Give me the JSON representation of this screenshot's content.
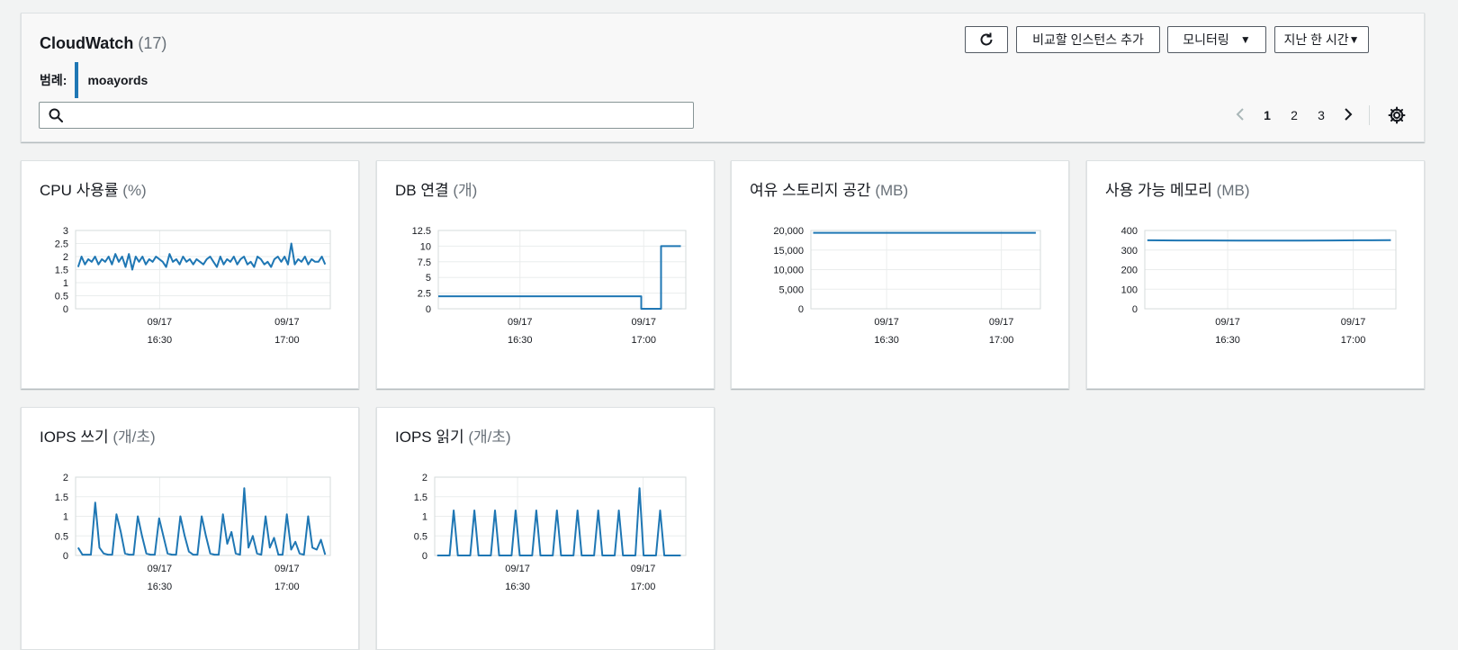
{
  "header": {
    "title": "CloudWatch",
    "count": "(17)",
    "legend_label": "범례:",
    "legend_value": "moayords",
    "search_placeholder": "",
    "buttons": {
      "compare": "비교할 인스턴스 추가",
      "monitoring": "모니터링",
      "time": "지난 한 시간"
    },
    "pages": [
      "1",
      "2",
      "3"
    ],
    "current_page": "1",
    "accent_color": "#1f77b4"
  },
  "cards": [
    {
      "title": "CPU 사용률",
      "unit": "(%)",
      "chart_data": {
        "type": "line",
        "y_ticks": [
          "3",
          "2.5",
          "2",
          "1.5",
          "1",
          "0.5",
          "0"
        ],
        "ylim": [
          0,
          3
        ],
        "x_ticks": [
          {
            "date": "09/17",
            "time": "16:30"
          },
          {
            "date": "09/17",
            "time": "17:00"
          }
        ],
        "x_tick_pos": [
          0.33,
          0.83
        ],
        "series": [
          {
            "values": [
              1.6,
              2.0,
              1.7,
              1.9,
              1.8,
              2.0,
              1.7,
              1.9,
              1.8,
              2.0,
              1.7,
              2.1,
              1.8,
              2.0,
              1.6,
              2.1,
              1.5,
              2.0,
              1.8,
              2.0,
              1.7,
              1.9,
              1.8,
              2.0,
              1.9,
              1.8,
              1.6,
              2.1,
              1.8,
              1.9,
              1.7,
              2.0,
              1.8,
              1.9,
              1.7,
              1.9,
              1.8,
              1.7,
              1.9,
              2.0,
              1.8,
              1.6,
              2.0,
              1.7,
              1.9,
              1.8,
              2.0,
              1.7,
              1.9,
              2.0,
              1.7,
              1.8,
              1.6,
              2.0,
              1.9,
              1.7,
              1.8,
              1.6,
              1.9,
              2.0,
              1.8,
              2.0,
              1.7,
              2.5,
              1.7,
              1.9,
              1.8,
              2.0,
              1.7,
              1.9,
              1.8,
              1.8,
              2.0,
              1.7
            ]
          }
        ]
      }
    },
    {
      "title": "DB 연결",
      "unit": "(개)",
      "chart_data": {
        "type": "line",
        "step": true,
        "y_ticks": [
          "12.5",
          "10",
          "7.5",
          "5",
          "2.5",
          "0"
        ],
        "ylim": [
          0,
          12.5
        ],
        "x_ticks": [
          {
            "date": "09/17",
            "time": "16:30"
          },
          {
            "date": "09/17",
            "time": "17:00"
          }
        ],
        "x_tick_pos": [
          0.33,
          0.83
        ],
        "series": [
          {
            "x": [
              0.0,
              0.82,
              0.82,
              0.9,
              0.9,
              0.98
            ],
            "values": [
              2,
              2,
              0,
              0,
              10,
              10
            ]
          }
        ]
      }
    },
    {
      "title": "여유 스토리지 공간",
      "unit": "(MB)",
      "chart_data": {
        "type": "line",
        "y_ticks": [
          "20,000",
          "15,000",
          "10,000",
          "5,000",
          "0"
        ],
        "ylim": [
          0,
          20000
        ],
        "x_ticks": [
          {
            "date": "09/17",
            "time": "16:30"
          },
          {
            "date": "09/17",
            "time": "17:00"
          }
        ],
        "x_tick_pos": [
          0.33,
          0.83
        ],
        "series": [
          {
            "values": [
              19400,
              19400,
              19400,
              19400
            ]
          }
        ]
      }
    },
    {
      "title": "사용 가능 메모리",
      "unit": "(MB)",
      "chart_data": {
        "type": "line",
        "y_ticks": [
          "400",
          "300",
          "200",
          "100",
          "0"
        ],
        "ylim": [
          0,
          400
        ],
        "x_ticks": [
          {
            "date": "09/17",
            "time": "16:30"
          },
          {
            "date": "09/17",
            "time": "17:00"
          }
        ],
        "x_tick_pos": [
          0.33,
          0.83
        ],
        "series": [
          {
            "values": [
              350,
              349,
              349,
              348,
              348,
              348,
              349,
              350,
              351
            ]
          }
        ]
      }
    },
    {
      "title": "IOPS 쓰기",
      "unit": "(개/초)",
      "chart_data": {
        "type": "line",
        "y_ticks": [
          "2",
          "1.5",
          "1",
          "0.5",
          "0"
        ],
        "ylim": [
          0,
          2
        ],
        "x_ticks": [
          {
            "date": "09/17",
            "time": "16:30"
          },
          {
            "date": "09/17",
            "time": "17:00"
          }
        ],
        "x_tick_pos": [
          0.33,
          0.83
        ],
        "series": [
          {
            "values": [
              0.2,
              0.02,
              0.02,
              0.02,
              1.35,
              0.2,
              0.05,
              0.02,
              0.02,
              1.05,
              0.6,
              0.05,
              0.02,
              0.02,
              1.0,
              0.5,
              0.05,
              0.02,
              0.02,
              0.95,
              0.5,
              0.05,
              0.02,
              0.02,
              1.0,
              0.5,
              0.1,
              0.02,
              0.02,
              1.0,
              0.5,
              0.05,
              0.02,
              0.02,
              1.05,
              0.3,
              0.6,
              0.05,
              0.02,
              1.72,
              0.2,
              0.5,
              0.05,
              0.02,
              1.0,
              0.2,
              0.45,
              0.02,
              0.02,
              1.05,
              0.15,
              0.35,
              0.05,
              0.02,
              1.0,
              0.2,
              0.15,
              0.4,
              0.02
            ]
          }
        ]
      }
    },
    {
      "title": "IOPS 읽기",
      "unit": "(개/초)",
      "chart_data": {
        "type": "line",
        "y_ticks": [
          "2",
          "1.5",
          "1",
          "0.5",
          "0"
        ],
        "ylim": [
          0,
          2
        ],
        "x_ticks": [
          {
            "date": "09/17",
            "time": "16:30"
          },
          {
            "date": "09/17",
            "time": "17:00"
          }
        ],
        "x_tick_pos": [
          0.33,
          0.83
        ],
        "series": [
          {
            "values": [
              0,
              0,
              0,
              0,
              1.15,
              0,
              0,
              0,
              0,
              1.15,
              0,
              0,
              0,
              0,
              1.15,
              0,
              0,
              0,
              0,
              1.15,
              0,
              0,
              0,
              0,
              1.15,
              0,
              0,
              0,
              0,
              1.15,
              0,
              0,
              0,
              0,
              1.15,
              0,
              0,
              0,
              0,
              1.15,
              0,
              0,
              0,
              0,
              1.15,
              0,
              0,
              0,
              0,
              1.72,
              0,
              0,
              0,
              0,
              1.15,
              0,
              0,
              0,
              0,
              0
            ]
          }
        ]
      }
    }
  ]
}
